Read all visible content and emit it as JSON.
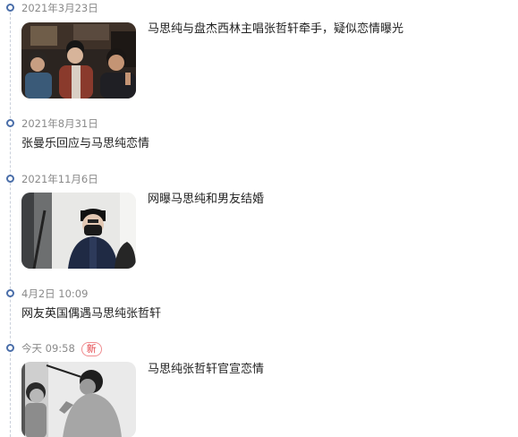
{
  "timeline": {
    "items": [
      {
        "date": "2021年3月23日",
        "title": "马思纯与盘杰西林主唱张哲轩牵手，疑似恋情曝光",
        "thumbnail": "photo-three-people-night"
      },
      {
        "date": "2021年8月31日",
        "title": "张曼乐回应与马思纯恋情"
      },
      {
        "date": "2021年11月6日",
        "title": "网曝马思纯和男友结婚",
        "thumbnail": "photo-woman-in-mask-street"
      },
      {
        "date": "4月2日 10:09",
        "title": "网友英国偶遇马思纯张哲轩"
      },
      {
        "date": "今天 09:58",
        "badge": "新",
        "title": "马思纯张哲轩官宣恋情",
        "thumbnail": "photo-black-and-white-couple"
      }
    ]
  },
  "colors": {
    "dot": "#4a6ea9",
    "badge": "#e5484d",
    "date_text": "#8a8a8a",
    "title_text": "#222222"
  }
}
